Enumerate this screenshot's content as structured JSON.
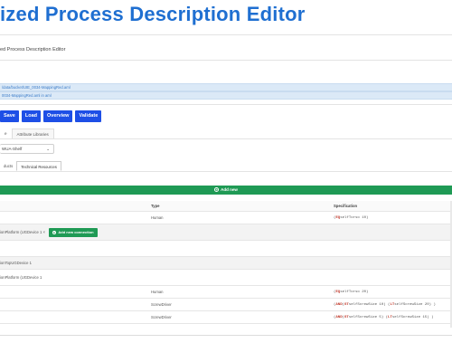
{
  "page": {
    "title": "ized Process Description Editor",
    "subtitle": "ed Process Description Editor"
  },
  "paths": {
    "path1": "/data/bucket/UIE_0034-MappingRed.aml",
    "path2": "0034-MappingRed.aml in aml"
  },
  "toolbar": {
    "save_label": "Save",
    "load_label": "Load",
    "overview_label": "Overview",
    "validate_label": "Validate"
  },
  "tabs_top": [
    "e",
    "Attribute Libraries"
  ],
  "selector": {
    "value": "WUA-Shelf",
    "caret": "⌄"
  },
  "tabs_sub": [
    {
      "label": "ducts",
      "active": false
    },
    {
      "label": "Technical Resources",
      "active": true
    }
  ],
  "add_new_label": "Add new",
  "add_connection_label": "Add new connection",
  "table": {
    "headers": [
      "",
      "Type",
      "Specification"
    ],
    "rows": [
      {
        "c1": "",
        "type": "Human",
        "spec": [
          [
            "(",
            ""
          ],
          [
            " EQ ",
            "kw"
          ],
          [
            "selfTorso  10 ",
            ""
          ],
          [
            ")",
            ""
          ]
        ]
      },
      {
        "c1": "ionPlatform (UGDevice 1 ×",
        "type": "",
        "spec": [],
        "connection": true
      },
      {
        "c1": "",
        "type": "",
        "spec": []
      },
      {
        "c1": "ionTopUGDevice 1",
        "type": "",
        "spec": []
      },
      {
        "c1": "ionPlatform (UGDevice 1",
        "type": "",
        "spec": []
      },
      {
        "c1": "",
        "type": "Human",
        "spec": [
          [
            "(",
            ""
          ],
          [
            " EQ ",
            "kw"
          ],
          [
            "selfTorso  20 ",
            ""
          ],
          [
            ")",
            ""
          ]
        ]
      },
      {
        "c1": "",
        "type": "ScrewDriver",
        "spec": [
          [
            "(",
            ""
          ],
          [
            " AND ",
            "kw"
          ],
          [
            "(",
            ""
          ],
          [
            " GT ",
            "kw"
          ],
          [
            "selfScrewSize  10 ",
            ""
          ],
          [
            ") ( ",
            ""
          ],
          [
            "LT ",
            "kw"
          ],
          [
            "selfScrewSize  20 ",
            ""
          ],
          [
            ") )",
            ""
          ]
        ]
      },
      {
        "c1": "",
        "type": "ScrewDriver",
        "spec": [
          [
            "(",
            ""
          ],
          [
            " AND ",
            "kw"
          ],
          [
            "(",
            ""
          ],
          [
            " GT ",
            "kw"
          ],
          [
            "selfScrewSize  5 ",
            ""
          ],
          [
            ") ( ",
            ""
          ],
          [
            "LT ",
            "kw"
          ],
          [
            "selfScrewSize  15 ",
            ""
          ],
          [
            ") )",
            ""
          ]
        ]
      }
    ]
  },
  "icons": {
    "plus": "plus-circle-icon",
    "caret": "chevron-down-icon"
  },
  "colors": {
    "primary_button": "#1e4fe6",
    "success": "#1f9a55",
    "title": "#1f6fd1",
    "path_bar": "#dbe9f7",
    "keyword": "#c0392b"
  }
}
